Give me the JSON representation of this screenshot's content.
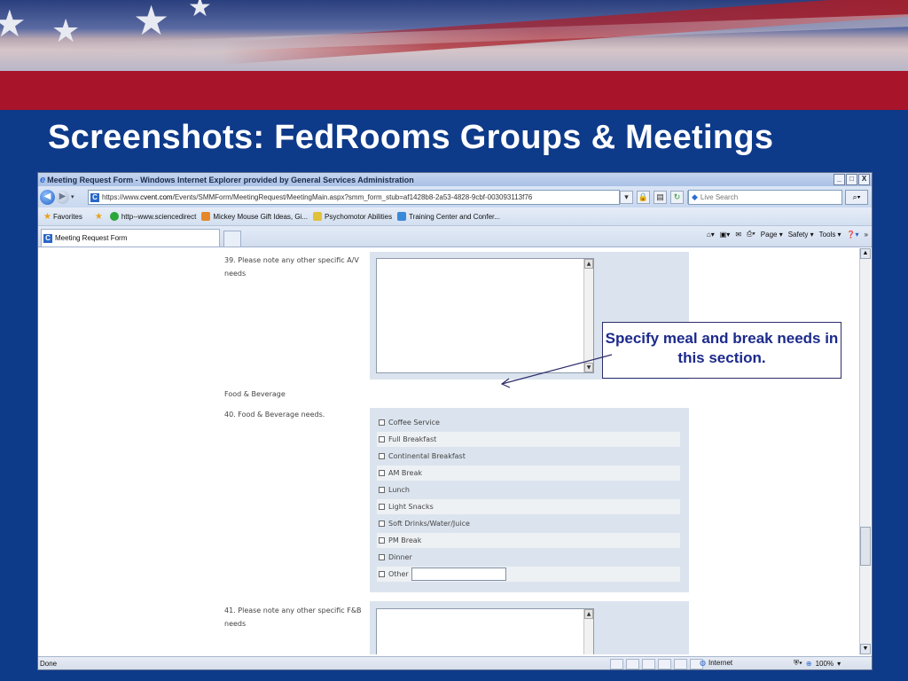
{
  "slide": {
    "title": "Screenshots: FedRooms Groups & Meetings",
    "callout": "Specify meal and break needs in this section."
  },
  "browser": {
    "window_title": "Meeting Request Form - Windows Internet Explorer provided by General Services Administration",
    "window_buttons": [
      "_",
      "□",
      "X"
    ],
    "address_prefix": "https://www.",
    "address_domain": "cvent.com",
    "address_path": "/Events/SMMForm/MeetingRequest/MeetingMain.aspx?smm_form_stub=af1428b8-2a53-4828-9cbf-003093113f76",
    "search_placeholder": "Live Search",
    "favorites": {
      "label": "Favorites",
      "items": [
        "http--www.sciencedirect",
        "Mickey Mouse Gift Ideas, Gi...",
        "Psychomotor Abilities",
        "Training Center and Confer..."
      ]
    },
    "tab_label": "Meeting Request Form",
    "command_bar": [
      "Page ▾",
      "Safety ▾",
      "Tools ▾"
    ],
    "status_text": "Done",
    "zone": "Internet",
    "zoom": "100%"
  },
  "form": {
    "q39_label": "39. Please note any other specific A/V needs",
    "section_header": "Food & Beverage",
    "q40_label": "40. Food & Beverage needs.",
    "q40_options": [
      "Coffee Service",
      "Full Breakfast",
      "Continental Breakfast",
      "AM Break",
      "Lunch",
      "Light Snacks",
      "Soft Drinks/Water/Juice",
      "PM Break",
      "Dinner",
      "Other"
    ],
    "q41_label": "41. Please note any other specific F&B needs"
  }
}
